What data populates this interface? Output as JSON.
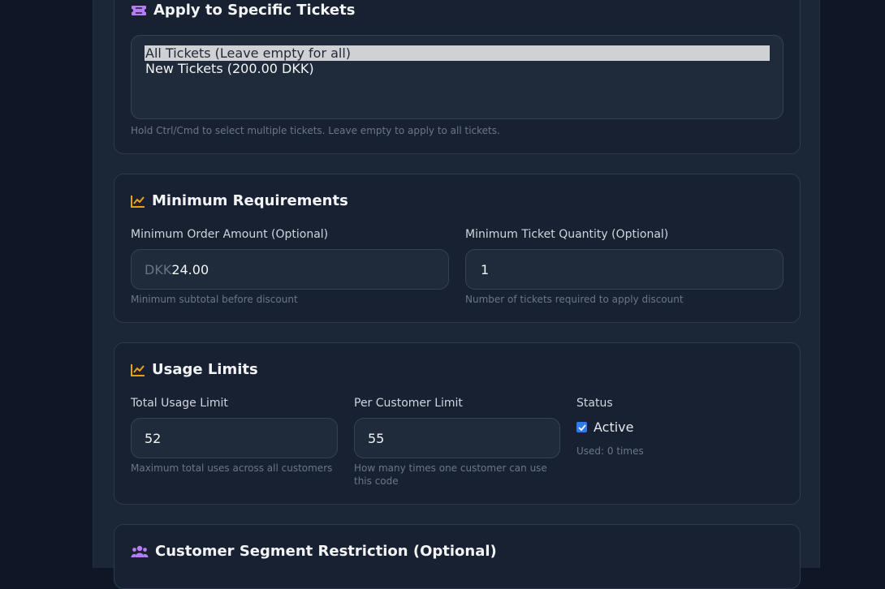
{
  "tickets_section": {
    "title": "Apply to Specific Tickets",
    "icon": "ticket-icon",
    "options": [
      "All Tickets (Leave empty for all)",
      "New Tickets (200.00 DKK)"
    ],
    "selected_option": "All Tickets (Leave empty for all)",
    "hint": "Hold Ctrl/Cmd to select multiple tickets. Leave empty to apply to all tickets."
  },
  "min_requirements": {
    "title": "Minimum Requirements",
    "icon": "chart-line-icon",
    "min_order_label": "Minimum Order Amount (Optional)",
    "currency_prefix": "DKK",
    "min_order_value": "24.00",
    "min_order_hint": "Minimum subtotal before discount",
    "min_qty_label": "Minimum Ticket Quantity (Optional)",
    "min_qty_value": "1",
    "min_qty_hint": "Number of tickets required to apply discount"
  },
  "usage_limits": {
    "title": "Usage Limits",
    "icon": "chart-line-icon",
    "total_label": "Total Usage Limit",
    "total_value": "52",
    "total_hint": "Maximum total uses across all customers",
    "per_customer_label": "Per Customer Limit",
    "per_customer_value": "55",
    "per_customer_hint": "How many times one customer can use this code",
    "status_label": "Status",
    "active_label": "Active",
    "active_checked": true,
    "used_text": "Used: 0 times"
  },
  "segment_section": {
    "title": "Customer Segment Restriction (Optional)",
    "icon": "users-icon"
  },
  "colors": {
    "ticket_icon": "#b67cf5",
    "chart_icon": "#f59e0b",
    "users_icon": "#b67cf5",
    "checkbox": "#2f7be8"
  }
}
